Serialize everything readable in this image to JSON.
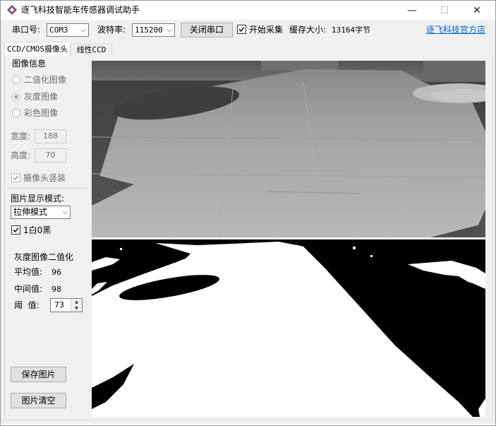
{
  "window": {
    "title": "逐飞科技智能车传感器调试助手",
    "controls": {
      "minimize": "—",
      "maximize": "☐",
      "close": "✕"
    }
  },
  "toolbar": {
    "port_label": "串口号:",
    "port_value": "COM3",
    "baud_label": "波特率:",
    "baud_value": "115200",
    "close_port_button": "关闭串口",
    "start_collect_label": "开始采集",
    "start_collect_checked": true,
    "buffer_label": "缓存大小:",
    "buffer_value": "13164字节",
    "website_link": "逐飞科技官方店"
  },
  "tabs": [
    {
      "label": "CCD/CMOS摄像头",
      "active": true
    },
    {
      "label": "线性CCD",
      "active": false
    }
  ],
  "image_info": {
    "group_label": "图像信息",
    "modes": [
      {
        "label": "二值化图像",
        "selected": false
      },
      {
        "label": "灰度图像",
        "selected": true
      },
      {
        "label": "彩色图像",
        "selected": false
      }
    ],
    "width_label": "宽度:",
    "width_value": "188",
    "height_label": "高度:",
    "height_value": "70",
    "vertical_label": "摄像头竖装",
    "vertical_checked": true
  },
  "display": {
    "mode_label": "图片显示模式:",
    "mode_value": "拉伸模式",
    "white_black_label": "1白0黑",
    "white_black_checked": true
  },
  "binarize": {
    "title": "灰度图像二值化",
    "avg_label": "平均值:",
    "avg_value": "96",
    "median_label": "中间值:",
    "median_value": "98",
    "threshold_label": "阈  值:",
    "threshold_value": "73"
  },
  "buttons": {
    "save_image": "保存图片",
    "clear_image": "图片清空"
  },
  "colors": {
    "link": "#0066cc",
    "background": "#f0f0f0",
    "button_face": "#e1e1e1"
  }
}
